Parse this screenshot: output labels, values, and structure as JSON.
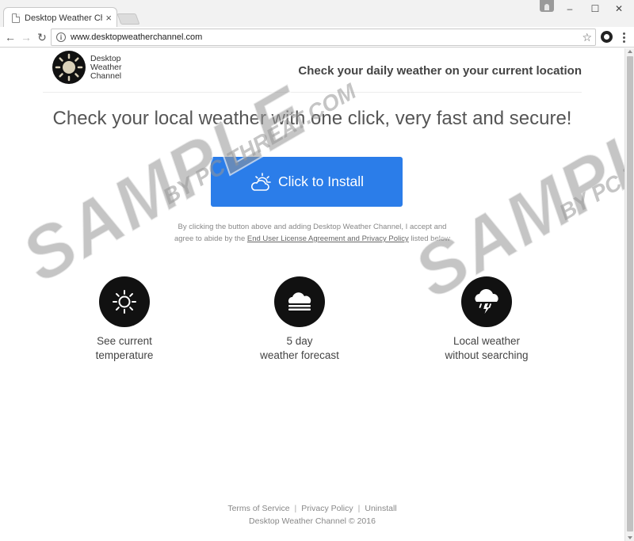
{
  "browser": {
    "tab_title": "Desktop Weather Channel",
    "tab_close": "×",
    "url": "www.desktopweatherchannel.com",
    "window_minimize": "–",
    "window_maximize": "☐",
    "window_close": "✕",
    "back": "←",
    "forward": "→",
    "reload": "↻",
    "info": "i",
    "bookmark": "☆"
  },
  "header": {
    "brand_line1": "Desktop",
    "brand_line2": "Weather",
    "brand_line3": "Channel",
    "tagline": "Check your daily weather on your current location"
  },
  "main": {
    "headline": "Check your local weather with one click, very fast and secure!",
    "install_label": "Click to Install",
    "disclaimer_line1": "By clicking the button above and adding Desktop Weather Channel, I accept and",
    "disclaimer_line2_pre": "agree to abide by the ",
    "disclaimer_link": "End User License Agreement and Privacy Policy",
    "disclaimer_line2_post": " listed below"
  },
  "features": [
    {
      "icon": "sun-icon",
      "line1": "See current",
      "line2": "temperature"
    },
    {
      "icon": "cloud-icon",
      "line1": "5 day",
      "line2": "weather forecast"
    },
    {
      "icon": "rain-cloud-icon",
      "line1": "Local weather",
      "line2": "without searching"
    }
  ],
  "footer": {
    "terms": "Terms of Service",
    "privacy": "Privacy Policy",
    "uninstall": "Uninstall",
    "separator": "|",
    "copyright": "Desktop Weather Channel © 2016"
  },
  "watermark": {
    "big": "SAMPLE",
    "small": "BY PC THREAT.COM"
  },
  "colors": {
    "install_button": "#2b7de9",
    "icon_circle": "#111111"
  }
}
